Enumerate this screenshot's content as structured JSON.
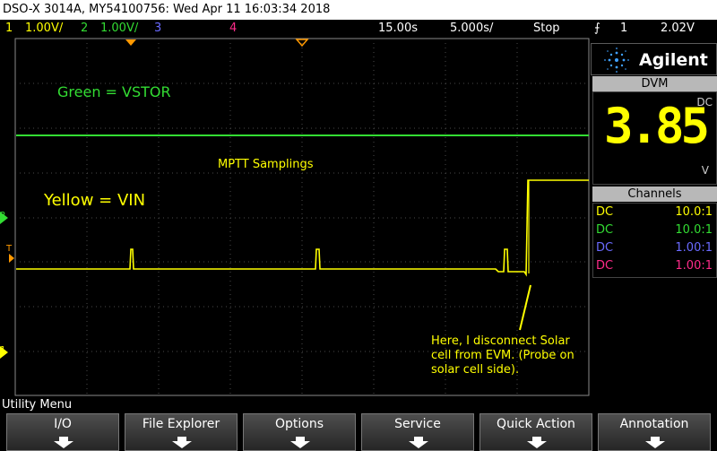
{
  "title_bar": {
    "text": "DSO-X 3014A, MY54100756: Wed Apr 11 16:03:34 2018"
  },
  "channels_bar": {
    "ch1": {
      "num": "1",
      "scale": "1.00V/",
      "color": "#ffff00"
    },
    "ch2": {
      "num": "2",
      "scale": "1.00V/",
      "color": "#33dd33"
    },
    "ch3": {
      "num": "3",
      "color": "#6a6aff"
    },
    "ch4": {
      "num": "4",
      "color": "#ff2b8a"
    },
    "time_position": "15.00s",
    "time_scale": "5.000s/",
    "run_state": "Stop",
    "trigger_channel": "1",
    "trigger_level": "2.02V"
  },
  "annotations": {
    "green_label": "Green = VSTOR",
    "mptt": "MPTT Samplings",
    "yellow_label": "Yellow = VIN",
    "note_line1": "Here, I disconnect Solar",
    "note_line2": "cell from EVM. (Probe on",
    "note_line3": "solar cell side)."
  },
  "markers": {
    "ch2": "2",
    "ch1": "1",
    "trigger": "T"
  },
  "sidebar": {
    "brand": "Agilent",
    "dvm_title": "DVM",
    "dvm_mode": "DC",
    "dvm_value": "3.85",
    "dvm_unit": "V",
    "channels_title": "Channels",
    "channels": [
      {
        "coupling": "DC",
        "ratio": "10.0:1",
        "color": "#ffff00"
      },
      {
        "coupling": "DC",
        "ratio": "10.0:1",
        "color": "#33dd33"
      },
      {
        "coupling": "DC",
        "ratio": "1.00:1",
        "color": "#6a6aff"
      },
      {
        "coupling": "DC",
        "ratio": "1.00:1",
        "color": "#ff2b8a"
      }
    ]
  },
  "menu": {
    "title": "Utility Menu",
    "softkeys": [
      "I/O",
      "File Explorer",
      "Options",
      "Service",
      "Quick Action",
      "Annotation"
    ]
  },
  "colors": {
    "ch1": "#ffff00",
    "ch2": "#33dd33",
    "accent": "#ff9900"
  }
}
